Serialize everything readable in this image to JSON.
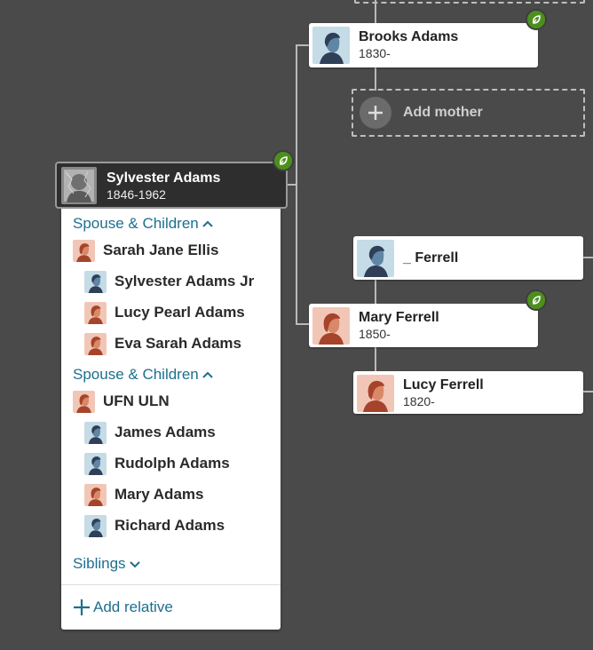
{
  "colors": {
    "background": "#4a4a4a",
    "link": "#1d6f8e",
    "hint_green": "#4d8f1e",
    "male_avatar_bg": "#c5dbe6",
    "female_avatar_bg": "#f2c6b6"
  },
  "focus_person": {
    "name": "Sylvester Adams",
    "dates": "1846-1962",
    "photo_icon": "photo-icon"
  },
  "tree": {
    "father": {
      "name": "Brooks Adams",
      "dates": "1830-",
      "avatar_icon": "male-avatar-icon",
      "hint_icon": "leaf-hint-icon"
    },
    "add_mother": {
      "label": "Add mother",
      "icon": "plus-icon"
    },
    "mother": {
      "name": "Mary Ferrell",
      "dates": "1850-",
      "avatar_icon": "female-avatar-icon",
      "hint_icon": "leaf-hint-icon"
    },
    "maternal_grandfather": {
      "name": "_ Ferrell",
      "avatar_icon": "male-avatar-icon"
    },
    "maternal_grandmother": {
      "name": "Lucy Ferrell",
      "dates": "1820-",
      "avatar_icon": "female-avatar-icon"
    }
  },
  "panel": {
    "families": [
      {
        "section_label": "Spouse & Children",
        "spouse": {
          "name": "Sarah Jane Ellis",
          "gender": "female"
        },
        "children": [
          {
            "name": "Sylvester Adams Jr",
            "gender": "male"
          },
          {
            "name": "Lucy Pearl Adams",
            "gender": "female"
          },
          {
            "name": "Eva Sarah Adams",
            "gender": "female"
          }
        ]
      },
      {
        "section_label": "Spouse & Children",
        "spouse": {
          "name": "UFN ULN",
          "gender": "female"
        },
        "children": [
          {
            "name": "James Adams",
            "gender": "male"
          },
          {
            "name": "Rudolph Adams",
            "gender": "male"
          },
          {
            "name": "Mary Adams",
            "gender": "female"
          },
          {
            "name": "Richard Adams",
            "gender": "male"
          }
        ]
      }
    ],
    "siblings_label": "Siblings",
    "add_relative_label": "Add relative"
  }
}
